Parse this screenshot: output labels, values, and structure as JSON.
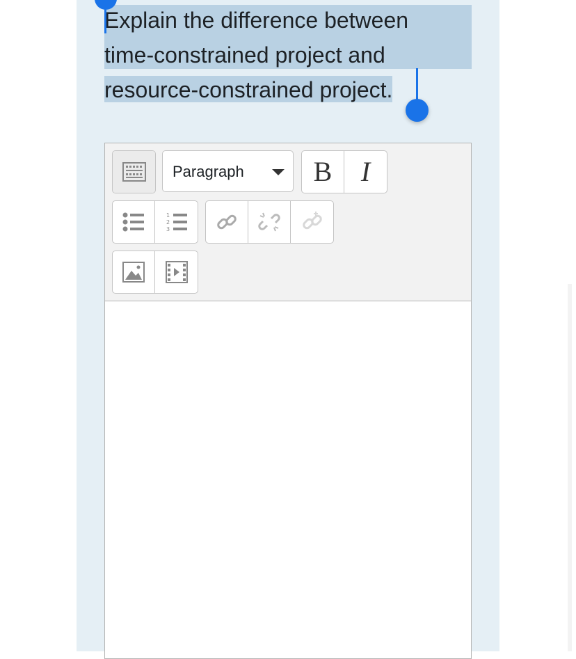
{
  "question": {
    "lines": [
      "Explain the difference between",
      "time-constrained project and",
      "resource-constrained project."
    ]
  },
  "editor": {
    "toolbar": {
      "toggle_icon": "toolbar-toggle-icon",
      "paragraph_select": {
        "selected": "Paragraph"
      },
      "bold_label": "B",
      "italic_label": "I",
      "icons": [
        "bullet-list-icon",
        "numbered-list-icon",
        "link-icon",
        "unlink-icon",
        "autolink-icon",
        "image-icon",
        "media-icon"
      ]
    },
    "content": ""
  },
  "colors": {
    "panel_bg": "#e5eff5",
    "selection": "#b9d1e3",
    "selection_handle": "#1a73e8",
    "toolbar_bg": "#f2f2f2"
  }
}
